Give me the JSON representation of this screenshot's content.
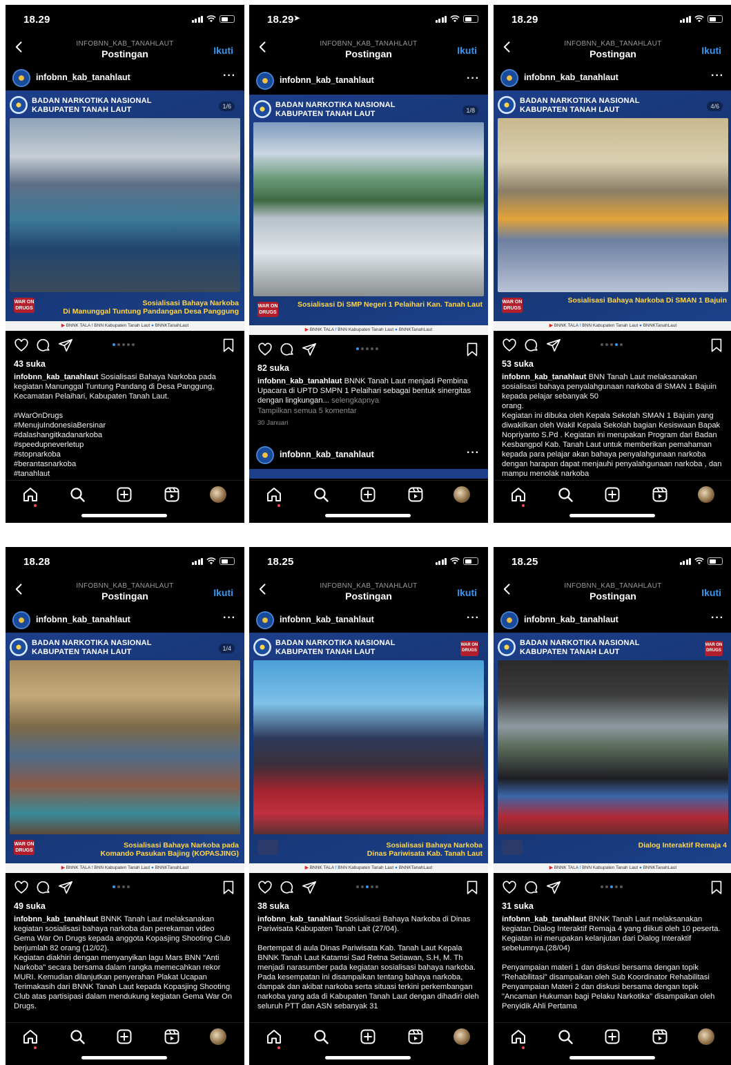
{
  "common": {
    "nav_subtitle": "INFOBNN_KAB_TANAHLAUT",
    "nav_title": "Postingan",
    "follow_label": "Ikuti",
    "username": "infobnn_kab_tanahlaut",
    "more_label": "···",
    "org_line1": "BADAN NARKOTIKA NASIONAL",
    "org_line2": "KABUPATEN TANAH LAUT",
    "footer_youtube": "BNNK TALA",
    "footer_facebook": "BNN Kabupaten Tanah Laut",
    "footer_twitter": "BNNKTanahLaut",
    "war_badge": "WAR ON DRUGS"
  },
  "colors": {
    "accent_blue": "#3897f0",
    "caption_yellow": "#ffd64a",
    "poster_blue": "#1d3f8a",
    "notif_red": "#ed4956"
  },
  "phones": [
    {
      "time": "18.29",
      "counter": "1/6",
      "photo_caption1": "Sosialisasi  Bahaya Narkoba",
      "photo_caption2": "Di Manunggal Tuntung Pandangan Desa Panggung",
      "likes": "43 suka",
      "caption": "Sosialisasi Bahaya Narkoba pada kegiatan Manunggal Tuntung Pandang di Desa Panggung, Kecamatan Pelaihari, Kabupaten Tanah Laut.\n\n#WarOnDrugs\n#MenujuIndonesiaBersinar\n#dalashangitkadanarkoba\n#speedupneverletup\n#stopnarkoba\n#berantasnarkoba\n#tanahlaut"
    },
    {
      "time": "18.29",
      "counter": "1/8",
      "photo_caption1": "Sosialisasi Di SMP Negeri 1 Pelaihari Kan. Tanah Laut",
      "photo_caption2": "",
      "likes": "82 suka",
      "caption": "BNNK Tanah Laut menjadi Pembina Upacara di UPTD SMPN  1 Pelaihari  sebagai bentuk sinergitas dengan lingkungan...",
      "more": "selengkapnya",
      "comments": "Tampilkan semua 5 komentar",
      "date": "30 Januari"
    },
    {
      "time": "18.29",
      "counter": "4/6",
      "photo_caption1": "Sosialisasi Bahaya Narkoba Di SMAN 1 Bajuin",
      "photo_caption2": "",
      "likes": "53 suka",
      "caption": "BNN Tanah Laut melaksanakan sosialisasi bahaya penyalahgunaan narkoba di SMAN 1 Bajuin kepada pelajar sebanyak 50\n orang.\nKegiatan ini dibuka oleh Kepala Sekolah SMAN 1 Bajuin yang diwakilkan oleh Wakil Kepala Sekolah bagian Kesiswaan Bapak Nopriyanto S.Pd . Kegiatan ini merupakan Program dari Badan Kesbangpol Kab. Tanah Laut untuk memberikan pemahaman kepada para pelajar akan bahaya penyalahgunaan narkoba dengan harapan dapat menjauhi penyalahgunaan narkoba , dan mampu menolak narkoba"
    },
    {
      "time": "18.28",
      "counter": "1/4",
      "photo_caption1": "Sosialisasi Bahaya Narkoba pada",
      "photo_caption2": "Komando Pasukan Bajing (KOPASJING)",
      "likes": "49 suka",
      "caption": "BNNK Tanah Laut melaksanakan kegiatan sosialisasi bahaya narkoba dan perekaman video Gema War On Drugs kepada anggota Kopasjing Shooting Club berjumlah 82 orang (12/02).\nKegiatan diakhiri dengan menyanyikan lagu Mars BNN \"Anti Narkoba\" secara bersama dalam rangka memecahkan rekor MURI. Kemudian dilanjutkan penyerahan Plakat Ucapan Terimakasih dari BNNK Tanah Laut kepada Kopasjing Shooting Club atas partisipasi dalam mendukung kegiatan Gema War On Drugs."
    },
    {
      "time": "18.25",
      "counter": "",
      "photo_caption1": "Sosialisasi Bahaya Narkoba",
      "photo_caption2": "Dinas Pariwisata Kab. Tanah Laut",
      "likes": "38 suka",
      "caption": "Sosialisasi Bahaya Narkoba di Dinas Pariwisata Kabupaten Tanah Lait (27/04).\n\nBertempat di aula Dinas Pariwisata Kab. Tanah Laut Kepala BNNK Tanah Laut Katamsi Sad Retna Setiawan, S.H, M. Th menjadi narasumber pada kegiatan sosialisasi bahaya narkoba.\nPada kesempatan ini disampaikan tentang bahaya narkoba, dampak dan akibat narkoba serta situasi terkini perkembangan narkoba yang ada di Kabupaten Tanah Laut dengan dihadiri oleh seluruh PTT dan ASN  sebanyak 31"
    },
    {
      "time": "18.25",
      "counter": "",
      "photo_caption1": "Dialog Interaktif Remaja 4",
      "photo_caption2": "",
      "likes": "31 suka",
      "caption": "BNNK Tanah Laut melaksanakan kegiatan Dialog Interaktif Remaja 4 yang diikuti oleh 10 peserta. Kegiatan ini merupakan kelanjutan dari Dialog Interaktif sebelumnya.(28/04)\n\nPenyampaian materi 1 dan diskusi bersama dengan topik \"Rehabilitasi\" disampaikan oleh Sub Koordinator Rehabilitasi\nPenyampaian Materi 2 dan diskusi bersama dengan topik \"Ancaman Hukuman bagi Pelaku Narkotika\" disampaikan oleh Penyidik Ahli Pertama"
    }
  ]
}
